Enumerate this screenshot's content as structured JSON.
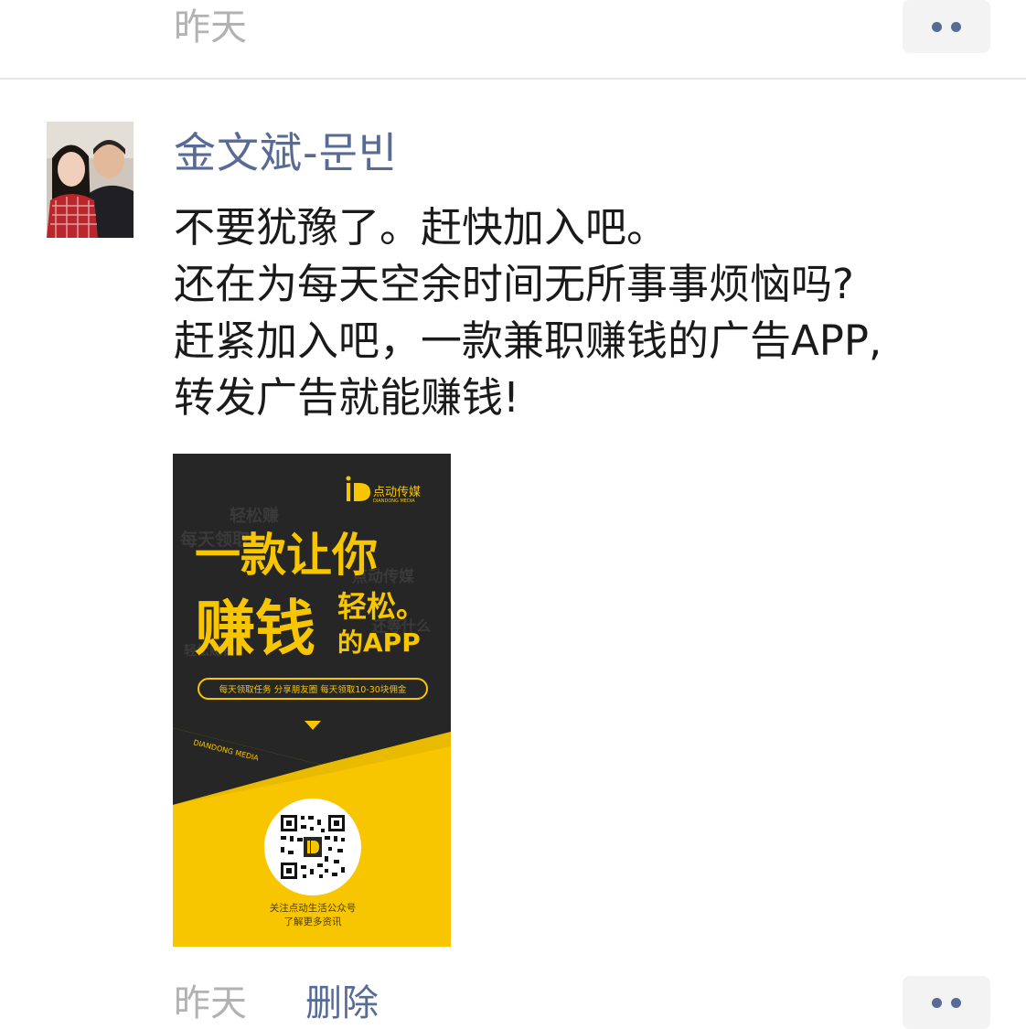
{
  "top": {
    "time": "昨天"
  },
  "post": {
    "author": "金文斌-문빈",
    "lines": [
      "不要犹豫了。赶快加入吧。",
      "还在为每天空余时间无所事事烦恼吗?",
      "赶紧加入吧，一款兼职赚钱的广告APP,",
      "转发广告就能赚钱!"
    ],
    "image": {
      "brand": "点动传媒",
      "brand_sub": "DIANDONG MEDIA",
      "bg_words": [
        "轻松赚",
        "每天领取",
        "点动传媒",
        "还等什么",
        "轻松赚钱"
      ],
      "headline_1": "一款让你",
      "headline_2": "赚钱",
      "headline_3": "轻松。",
      "headline_4": "的APP",
      "pill_text": "每天领取任务  分享朋友圈  每天领取10-30块佣金",
      "diagonal_text": "DIANDONG MEDIA",
      "qr_caption_1": "关注点动生活公众号",
      "qr_caption_2": "了解更多资讯"
    }
  },
  "footer": {
    "time": "昨天",
    "delete_label": "删除"
  },
  "colors": {
    "link": "#576b95",
    "time": "#b2b2b2",
    "poster_bg": "#262626",
    "poster_accent": "#f7c600"
  },
  "icons": {
    "more": "more-dots-icon",
    "qr": "qr-code-icon"
  }
}
